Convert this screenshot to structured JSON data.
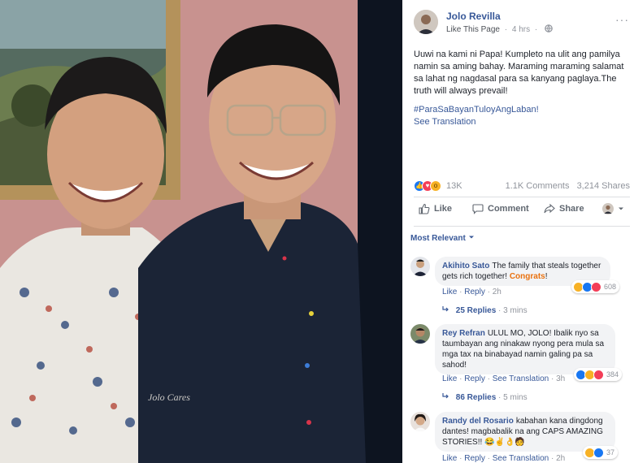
{
  "photo": {
    "watermark": "Jolo Cares"
  },
  "post": {
    "page_name": "Jolo Revilla",
    "like_page": "Like This Page",
    "time": "4 hrs",
    "text": "Uuwi na kami ni Papa! Kumpleto na ulit ang pamilya namin sa aming bahay. Maraming maraming salamat sa lahat ng nagdasal para sa kanyang paglaya.The truth will always prevail!",
    "hashtag": "#ParaSaBayanTuloyAngLaban!",
    "see_translation": "See Translation",
    "reaction_count": "13K",
    "comments": "1.1K Comments",
    "shares": "3,214 Shares"
  },
  "actions": {
    "like": "Like",
    "comment": "Comment",
    "share": "Share"
  },
  "filter": {
    "label": "Most Relevant"
  },
  "comments": [
    {
      "name": "Akihito Sato",
      "text": "The family that steals together gets rich together!",
      "highlight": "Congrats",
      "after": "!",
      "like": "Like",
      "reply": "Reply",
      "time": "2h",
      "reactions": "608",
      "replies": "25 Replies",
      "replies_time": "3 mins"
    },
    {
      "name": "Rey Refran",
      "text": "ULUL MO, JOLO! Ibalik nyo sa taumbayan ang ninakaw nyong pera mula sa mga tax na binabayad namin galing pa sa sahod!",
      "like": "Like",
      "reply": "Reply",
      "see_translation": "See Translation",
      "time": "3h",
      "reactions": "384",
      "replies": "86 Replies",
      "replies_time": "5 mins"
    },
    {
      "name": "Randy del Rosario",
      "text": "kabahan kana dingdong dantes! magbabalik na ang CAPS AMAZING STORIES!!",
      "like": "Like",
      "reply": "Reply",
      "see_translation": "See Translation",
      "time": "2h",
      "reactions": "37"
    }
  ],
  "colors": {
    "link": "#385898",
    "accent_orange": "#e9710f",
    "like_blue": "#1877f2",
    "love_red": "#f33e58",
    "haha_yellow": "#f7b125"
  }
}
